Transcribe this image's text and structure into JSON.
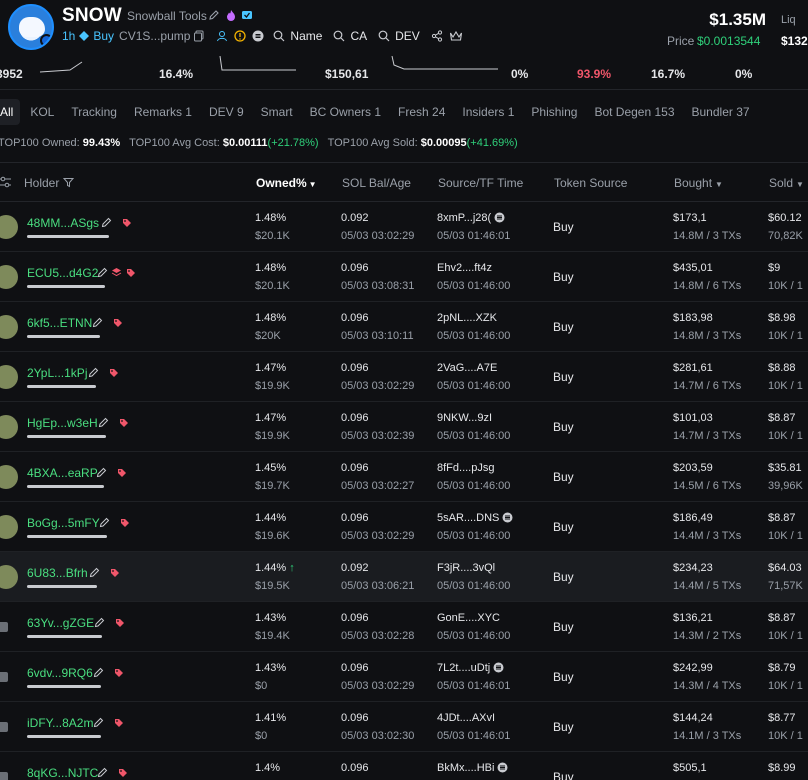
{
  "token": {
    "symbol": "SNOW",
    "name": "Snowball Tools",
    "age": "1h",
    "buy_label": "Buy",
    "contract_short": "CV1S...pump",
    "search_links": [
      "Name",
      "CA",
      "DEV"
    ],
    "market_cap": "$1.35M",
    "liquidity_label": "Liq",
    "liquidity_value": "$132",
    "price_label": "Price",
    "price_value": "$0.0013544"
  },
  "stats_strip": [
    "3952",
    "16.4%",
    "$150,61",
    "0%",
    "93.9%",
    "16.7%",
    "0%"
  ],
  "tabs": [
    "All",
    "KOL",
    "Tracking",
    "Remarks 1",
    "DEV 9",
    "Smart",
    "BC Owners 1",
    "Fresh 24",
    "Insiders 1",
    "Phishing",
    "Bot Degen 153",
    "Bundler 37"
  ],
  "summary": {
    "owned_label": "TOP100 Owned:",
    "owned_value": "99.43%",
    "cost_label": "TOP100 Avg Cost:",
    "cost_value": "$0.00111",
    "cost_change": "(+21.78%)",
    "sold_label": "TOP100 Avg Sold:",
    "sold_value": "$0.00095",
    "sold_change": "(+41.69%)"
  },
  "columns": {
    "holder": "Holder",
    "owned": "Owned%",
    "sol_bal": "SOL Bal/Age",
    "source": "Source/TF Time",
    "token_source": "Token Source",
    "bought": "Bought",
    "sold": "Sold"
  },
  "colors": {
    "accent_green": "#2fd07a",
    "accent_blue": "#49c5ff",
    "tag_pink": "#f0566a"
  },
  "rows": [
    {
      "holder": "48MM...ASgs",
      "owned": "1.48%",
      "owned_usd": "$20.1K",
      "sol": "0.092",
      "age": "05/03 03:02:29",
      "source": "8xmP...j28(",
      "tf": "05/03 01:46:01",
      "token_source": "Buy",
      "bought": "$173,1",
      "bought_sub": "14.8M / 3 TXs",
      "sold": "$60.12",
      "sold_sub": "70,82K"
    },
    {
      "holder": "ECU5...d4G2",
      "owned": "1.48%",
      "owned_usd": "$20.1K",
      "sol": "0.096",
      "age": "05/03 03:08:31",
      "source": "Ehv2....ft4z",
      "tf": "05/03 01:46:00",
      "token_source": "Buy",
      "bought": "$435,01",
      "bought_sub": "14.8M / 6 TXs",
      "sold": "$9",
      "sold_sub": "10K / 1"
    },
    {
      "holder": "6kf5...ETNN",
      "owned": "1.48%",
      "owned_usd": "$20K",
      "sol": "0.096",
      "age": "05/03 03:10:11",
      "source": "2pNL....XZK",
      "tf": "05/03 01:46:00",
      "token_source": "Buy",
      "bought": "$183,98",
      "bought_sub": "14.8M / 3 TXs",
      "sold": "$8.98",
      "sold_sub": "10K / 1"
    },
    {
      "holder": "2YpL...1kPj",
      "owned": "1.47%",
      "owned_usd": "$19.9K",
      "sol": "0.096",
      "age": "05/03 03:02:29",
      "source": "2VaG....A7E",
      "tf": "05/03 01:46:00",
      "token_source": "Buy",
      "bought": "$281,61",
      "bought_sub": "14.7M / 6 TXs",
      "sold": "$8.88",
      "sold_sub": "10K / 1"
    },
    {
      "holder": "HgEp...w3eH",
      "owned": "1.47%",
      "owned_usd": "$19.9K",
      "sol": "0.096",
      "age": "05/03 03:02:39",
      "source": "9NKW...9zI",
      "tf": "05/03 01:46:00",
      "token_source": "Buy",
      "bought": "$101,03",
      "bought_sub": "14.7M / 3 TXs",
      "sold": "$8.87",
      "sold_sub": "10K / 1"
    },
    {
      "holder": "4BXA...eaRP",
      "owned": "1.45%",
      "owned_usd": "$19.7K",
      "sol": "0.096",
      "age": "05/03 03:02:27",
      "source": "8fFd....pJsg",
      "tf": "05/03 01:46:00",
      "token_source": "Buy",
      "bought": "$203,59",
      "bought_sub": "14.5M / 6 TXs",
      "sold": "$35.81",
      "sold_sub": "39,96K"
    },
    {
      "holder": "BoGg...5mFY",
      "owned": "1.44%",
      "owned_usd": "$19.6K",
      "sol": "0.096",
      "age": "05/03 03:02:29",
      "source": "5sAR....DNS",
      "tf": "05/03 01:46:00",
      "token_source": "Buy",
      "bought": "$186,49",
      "bought_sub": "14.4M / 3 TXs",
      "sold": "$8.87",
      "sold_sub": "10K / 1"
    },
    {
      "holder": "6U83...Bfrh",
      "owned": "1.44%",
      "owned_usd": "$19.5K",
      "sol": "0.092",
      "age": "05/03 03:06:21",
      "source": "F3jR....3vQl",
      "tf": "05/03 01:46:00",
      "token_source": "Buy",
      "bought": "$234,23",
      "bought_sub": "14.4M / 5 TXs",
      "sold": "$64.03",
      "sold_sub": "71,57K"
    },
    {
      "holder": "63Yv...gZGE",
      "owned": "1.43%",
      "owned_usd": "$19.4K",
      "sol": "0.096",
      "age": "05/03 03:02:28",
      "source": "GonE....XYC",
      "tf": "05/03 01:46:00",
      "token_source": "Buy",
      "bought": "$136,21",
      "bought_sub": "14.3M / 2 TXs",
      "sold": "$8.87",
      "sold_sub": "10K / 1"
    },
    {
      "holder": "6vdv...9RQ6",
      "owned": "1.43%",
      "owned_usd": "$0",
      "sol": "0.096",
      "age": "05/03 03:02:29",
      "source": "7L2t....uDtj",
      "tf": "05/03 01:46:01",
      "token_source": "Buy",
      "bought": "$242,99",
      "bought_sub": "14.3M / 4 TXs",
      "sold": "$8.79",
      "sold_sub": "10K / 1"
    },
    {
      "holder": "iDFY...8A2m",
      "owned": "1.41%",
      "owned_usd": "$0",
      "sol": "0.096",
      "age": "05/03 03:02:30",
      "source": "4JDt....AXvI",
      "tf": "05/03 01:46:01",
      "token_source": "Buy",
      "bought": "$144,24",
      "bought_sub": "14.1M / 3 TXs",
      "sold": "$8.77",
      "sold_sub": "10K / 1"
    },
    {
      "holder": "8qKG...NJTC",
      "owned": "1.4%",
      "owned_usd": "",
      "sol": "0.096",
      "age": "",
      "source": "BkMx....HBi",
      "tf": "",
      "token_source": "Buy",
      "bought": "$505,1",
      "bought_sub": "",
      "sold": "$8.99",
      "sold_sub": ""
    }
  ]
}
